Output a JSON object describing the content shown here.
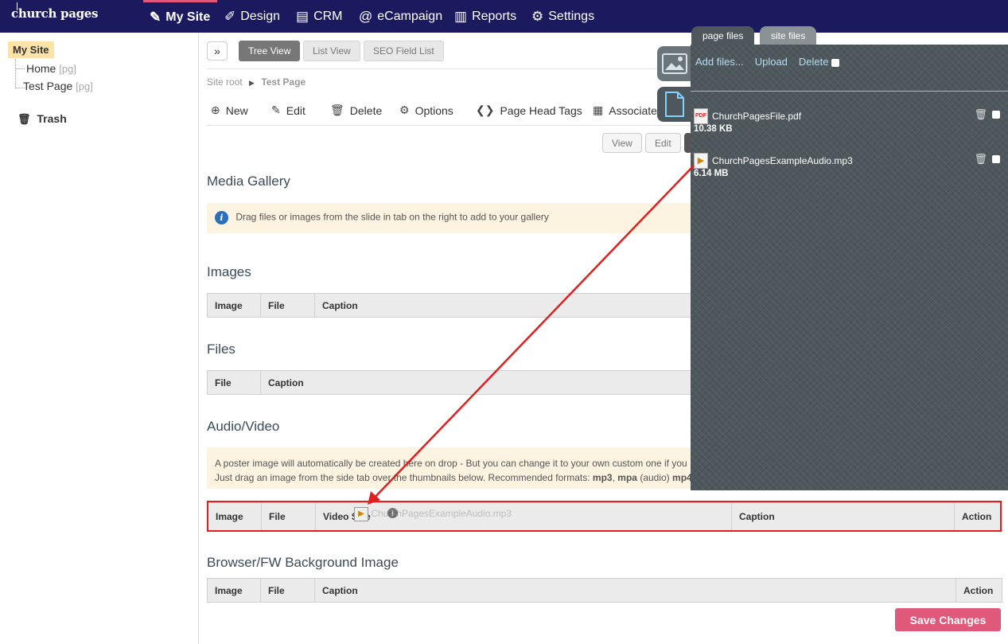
{
  "nav": {
    "logo": "church pages",
    "items": [
      {
        "label": "My Site",
        "icon": "my-site-icon"
      },
      {
        "label": "Design",
        "icon": "design-icon"
      },
      {
        "label": "CRM",
        "icon": "crm-icon"
      },
      {
        "label": "eCampaign",
        "icon": "at-icon"
      },
      {
        "label": "Reports",
        "icon": "reports-icon"
      },
      {
        "label": "Settings",
        "icon": "gear-icon"
      }
    ],
    "active_color": "#e0587a",
    "bar_color": "#1c1a5e"
  },
  "sidebar": {
    "root": "My Site",
    "pages": [
      {
        "label": "Home",
        "tag": "[pg]"
      },
      {
        "label": "Test Page",
        "tag": "[pg]"
      }
    ],
    "trash": "Trash"
  },
  "view_tabs": [
    "Tree View",
    "List View",
    "SEO Field List"
  ],
  "breadcrumb": {
    "root": "Site root",
    "current": "Test Page"
  },
  "toolbar": {
    "new": "New",
    "edit": "Edit",
    "delete": "Delete",
    "options": "Options",
    "page_head_tags": "Page Head Tags",
    "associated": "Associated"
  },
  "mode_buttons": {
    "view": "View",
    "edit": "Edit"
  },
  "media_gallery": {
    "title": "Media Gallery",
    "info": "Drag files or images from the slide in tab on the right to add to your gallery"
  },
  "images": {
    "title": "Images",
    "columns": [
      "Image",
      "File",
      "Caption"
    ]
  },
  "files": {
    "title": "Files",
    "columns": [
      "File",
      "Caption"
    ]
  },
  "audio_video": {
    "title": "Audio/Video",
    "note_line1": "A poster image will automatically be created here on drop - But you can change it to your own custom one if you",
    "note_line2_prefix": "Just drag an image from the side tab over the thumbnails below. Recommended formats:",
    "note_fmt1": "mp3",
    "note_sep1": ",",
    "note_fmt2": "mpa",
    "note_fmt2_suffix": "(audio)",
    "note_fmt3": "mp4",
    "columns": [
      "Image",
      "File",
      "Video Size",
      "Caption",
      "Action"
    ],
    "ghost_label": "ChurchPagesExampleAudio.mp3"
  },
  "background_image": {
    "title": "Browser/FW Background Image",
    "columns": [
      "Image",
      "File",
      "Caption",
      "Action"
    ]
  },
  "save_button": "Save Changes",
  "panel": {
    "tabs": [
      "page files",
      "site files"
    ],
    "actions": {
      "add_files": "Add files...",
      "upload": "Upload",
      "delete": "Delete"
    },
    "files": [
      {
        "name": "ChurchPagesFile.pdf",
        "size": "10.38 KB",
        "icon": "pdf-file-icon"
      },
      {
        "name": "ChurchPagesExampleAudio.mp3",
        "size": "6.14 MB",
        "icon": "audio-file-icon"
      }
    ]
  },
  "annotation": {
    "color": "#e02020"
  }
}
